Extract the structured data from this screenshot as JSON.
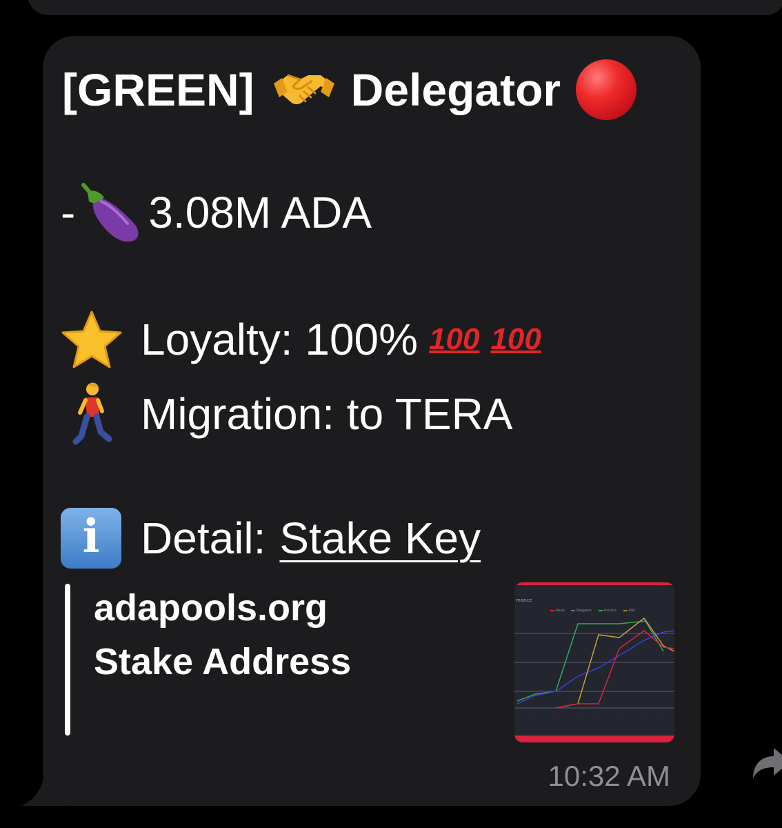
{
  "message": {
    "title_text": "[GREEN]",
    "title_role": "Delegator",
    "amount_prefix": "-",
    "amount_text": "3.08M ADA",
    "loyalty_text": "Loyalty: 100%",
    "hundred_label": "100",
    "migration_text": "Migration: to TERA",
    "detail_label": "Detail:",
    "detail_link": "Stake Key",
    "timestamp": "10:32 AM"
  },
  "link_preview": {
    "site": "adapools.org",
    "title": "Stake Address",
    "thumbnail_heading": "mance",
    "thumbnail_legend": [
      "Blocks",
      "Delegators",
      "Pool Size",
      "ROA"
    ]
  },
  "icons": {
    "handshake": "handshake-emoji",
    "status": "red-circle-emoji",
    "eggplant": "eggplant-emoji",
    "star": "star-emoji",
    "walker": "person-walking-emoji",
    "info": "information-emoji",
    "forward": "forward-arrow-icon"
  },
  "colors": {
    "bubble": "#1c1c1e",
    "background": "#000000",
    "text": "#ffffff",
    "timestamp": "#8e8e93",
    "hundred_red": "#e0262a",
    "thumb_border": "#d8243c"
  }
}
